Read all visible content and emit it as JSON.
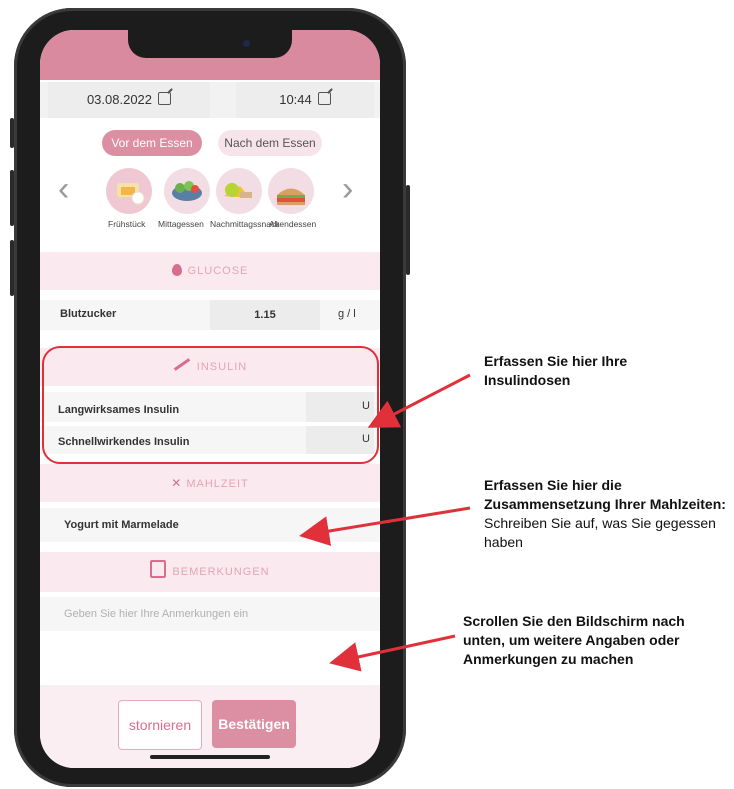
{
  "header": {
    "date": "03.08.2022",
    "time": "10:44"
  },
  "meal_timing": {
    "before_label": "Vor dem Essen",
    "after_label": "Nach dem Essen"
  },
  "meals": [
    {
      "label": "Frühstück"
    },
    {
      "label": "Mittagessen"
    },
    {
      "label": "Nachmittagssnack"
    },
    {
      "label": "Abendessen"
    }
  ],
  "glucose": {
    "section_title": "GLUCOSE",
    "label": "Blutzucker",
    "value": "1.15",
    "unit": "g / l"
  },
  "insulin": {
    "section_title": "INSULIN",
    "long_label": "Langwirksames Insulin",
    "long_value": "",
    "long_unit": "U",
    "short_label": "Schnellwirkendes Insulin",
    "short_value": "",
    "short_unit": "U"
  },
  "meal_section": {
    "section_title": "MAHLZEIT",
    "value": "Yogurt mit Marmelade"
  },
  "remarks": {
    "section_title": "BEMERKUNGEN",
    "placeholder": "Geben Sie hier Ihre Anmerkungen ein"
  },
  "actions": {
    "cancel_label": "stornieren",
    "confirm_label": "Bestätigen"
  },
  "annotations": {
    "insulin": "Erfassen Sie hier Ihre Insulindosen",
    "meal_bold": "Erfassen Sie hier die Zusammensetzung Ihrer Mahlzeiten:",
    "meal_regular": "Schreiben Sie auf, was Sie gegessen haben",
    "scroll": "Scrollen Sie den Bildschirm nach unten, um weitere Angaben oder Anmerkungen zu machen"
  },
  "colors": {
    "accent": "#dc8fa3",
    "section_bg": "#fae9ee",
    "callout": "#e0313a"
  },
  "icons": [
    "edit-icon",
    "chevron-left-icon",
    "chevron-right-icon",
    "drop-icon",
    "syringe-icon",
    "cutlery-icon",
    "notes-icon"
  ]
}
